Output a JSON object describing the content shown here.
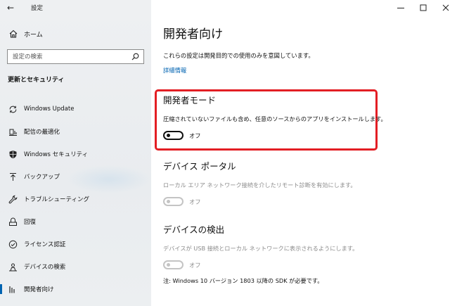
{
  "window": {
    "title": "設定",
    "back_glyph": "←",
    "minimize_glyph": "—",
    "maximize_glyph": "☐",
    "close_glyph": "✕"
  },
  "sidebar": {
    "home_label": "ホーム",
    "search_placeholder": "設定の検索",
    "section_header": "更新とセキュリティ",
    "items": [
      {
        "label": "Windows Update",
        "icon": "sync-icon"
      },
      {
        "label": "配信の最適化",
        "icon": "delivery-optimization-icon"
      },
      {
        "label": "Windows セキュリティ",
        "icon": "shield-icon"
      },
      {
        "label": "バックアップ",
        "icon": "backup-arrow-icon"
      },
      {
        "label": "トラブルシューティング",
        "icon": "wrench-icon"
      },
      {
        "label": "回復",
        "icon": "recovery-icon"
      },
      {
        "label": "ライセンス認証",
        "icon": "check-circle-icon"
      },
      {
        "label": "デバイスの検索",
        "icon": "person-location-icon"
      },
      {
        "label": "開発者向け",
        "icon": "developer-bars-icon",
        "active": true
      }
    ]
  },
  "main": {
    "title": "開発者向け",
    "intro": "これらの設定は開発目的での使用のみを意図しています。",
    "link": "詳細情報",
    "sections": [
      {
        "title": "開発者モード",
        "description": "圧縮されていないファイルも含め、任意のソースからのアプリをインストールします。",
        "toggle_label": "オフ",
        "enabled": true
      },
      {
        "title": "デバイス ポータル",
        "description": "ローカル エリア ネットワーク接続を介したリモート診断を有効にします。",
        "toggle_label": "オフ",
        "enabled": false
      },
      {
        "title": "デバイスの検出",
        "description": "デバイスが USB 接続とローカル ネットワークに表示されるようにします。",
        "toggle_label": "オフ",
        "enabled": false
      }
    ],
    "note": "注: Windows 10 バージョン 1803 以降の SDK が必要です。"
  },
  "colors": {
    "accent": "#0063b1",
    "highlight_border": "#e31e24",
    "disabled_text": "#8a8a8a"
  }
}
